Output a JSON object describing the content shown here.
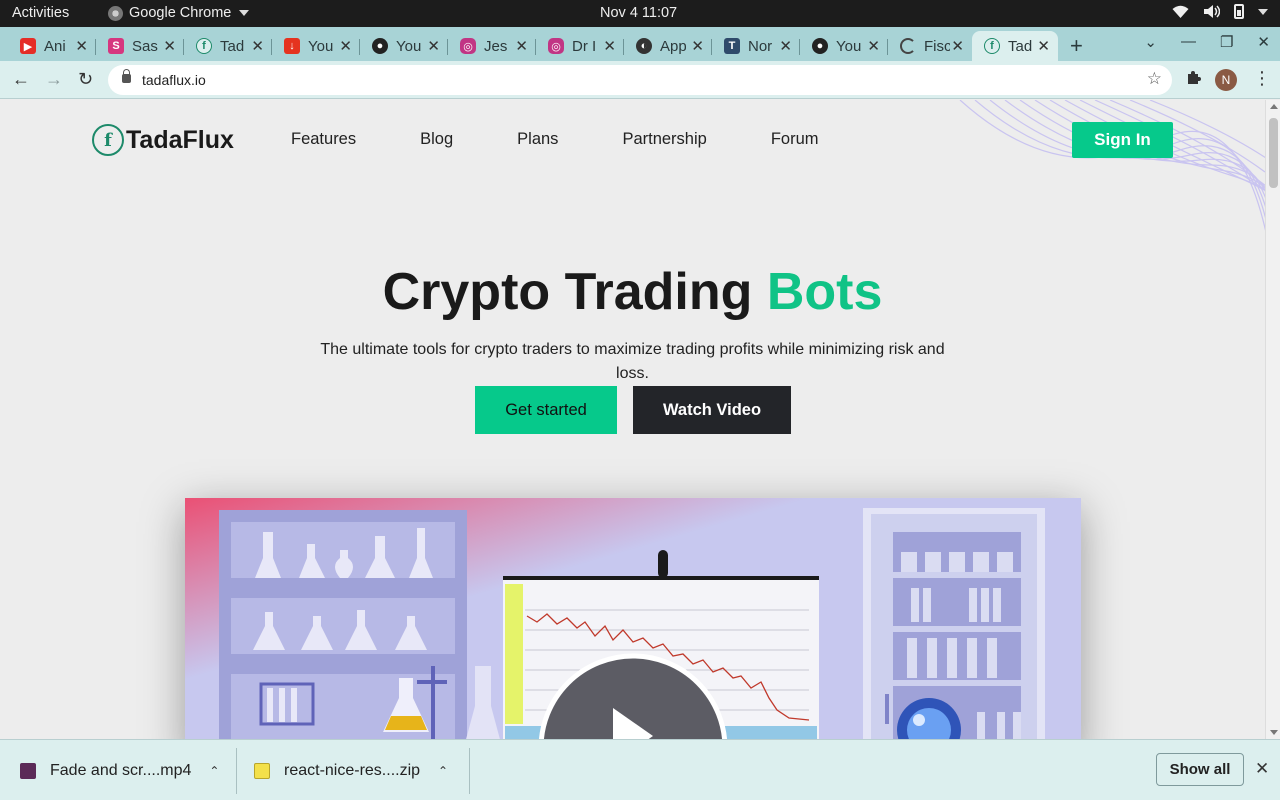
{
  "topbar": {
    "activities": "Activities",
    "app_name": "Google Chrome",
    "clock": "Nov 4  11:07"
  },
  "tabs": [
    {
      "label": "Ani",
      "favicon_color": "#e52d27"
    },
    {
      "label": "Sas",
      "favicon_color": "#d6367f"
    },
    {
      "label": "Tad",
      "favicon_color": "#1d8a6a"
    },
    {
      "label": "You",
      "favicon_color": "#e5331f"
    },
    {
      "label": "You",
      "favicon_color": "#222222"
    },
    {
      "label": "Jes",
      "favicon_color": "#c13584"
    },
    {
      "label": "Dr I",
      "favicon_color": "#c13584"
    },
    {
      "label": "App",
      "favicon_color": "#333333"
    },
    {
      "label": "Nor",
      "favicon_color": "#2f4a6b"
    },
    {
      "label": "You",
      "favicon_color": "#222222"
    },
    {
      "label": "Fisc",
      "favicon_color": "#444444"
    },
    {
      "label": "Tad",
      "favicon_color": "#1d8a6a"
    }
  ],
  "address_bar": {
    "url": "tadaflux.io"
  },
  "page": {
    "logo_text": "TadaFlux",
    "logo_mark": "f",
    "nav": [
      "Features",
      "Blog",
      "Plans",
      "Partnership",
      "Forum"
    ],
    "sign_in": "Sign In",
    "hero_title_main": "Crypto Trading ",
    "hero_title_accent": "Bots",
    "hero_subtitle": "The ultimate tools for crypto traders to maximize trading profits while minimizing risk and loss.",
    "get_started": "Get started",
    "watch_video": "Watch Video",
    "accent_color": "#06c98b"
  },
  "downloads": [
    {
      "name": "Fade and scr....mp4",
      "icon_color": "#5b2a57"
    },
    {
      "name": "react-nice-res....zip",
      "icon_color": "#f3e04a"
    }
  ],
  "show_all": "Show all",
  "profile_initial": "N"
}
